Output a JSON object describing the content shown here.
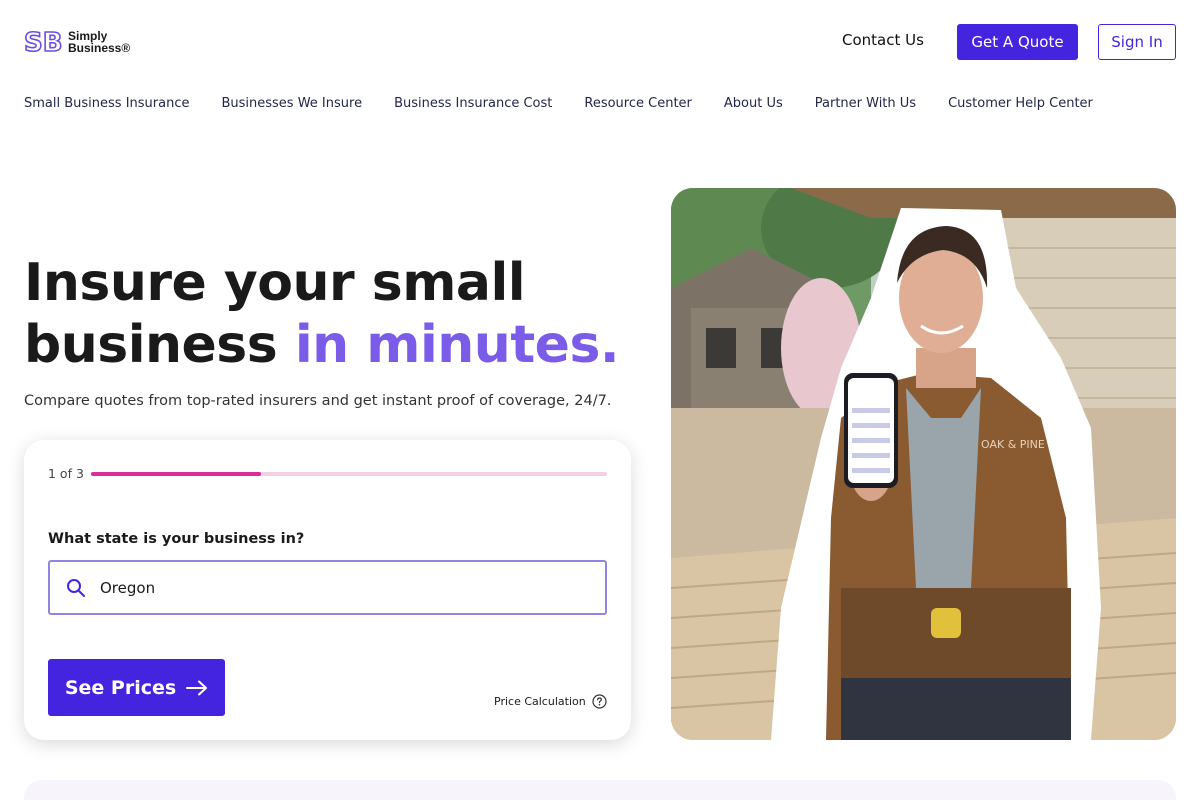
{
  "brand": {
    "logo_mark": "SB",
    "name_line1": "Simply",
    "name_line2": "Business®",
    "accent": "#4524e0",
    "headline_accent": "#7a5ce8"
  },
  "header": {
    "contact_label": "Contact Us",
    "quote_label": "Get A Quote",
    "signin_label": "Sign In"
  },
  "nav": {
    "items": [
      {
        "label": "Small Business Insurance"
      },
      {
        "label": "Businesses We Insure"
      },
      {
        "label": "Business Insurance Cost"
      },
      {
        "label": "Resource Center"
      },
      {
        "label": "About Us"
      },
      {
        "label": "Partner With Us"
      },
      {
        "label": "Customer Help Center"
      }
    ]
  },
  "hero": {
    "headline_part1": "Insure your small business",
    "headline_part2": "in minutes.",
    "subtitle": "Compare quotes from top-rated insurers and get instant proof of coverage, 24/7."
  },
  "form": {
    "step_text": "1 of 3",
    "progress_fraction": 0.33,
    "progress_fill_color": "#db2d99",
    "question": "What state is your business in?",
    "state_value": "Oregon",
    "search_icon": "search-icon",
    "cta_label": "See Prices",
    "cta_icon": "arrow-right-icon",
    "price_calc_label": "Price Calculation",
    "price_calc_icon": "help-circle-icon"
  },
  "photo": {
    "shirt_text": "OAK & PINE"
  }
}
